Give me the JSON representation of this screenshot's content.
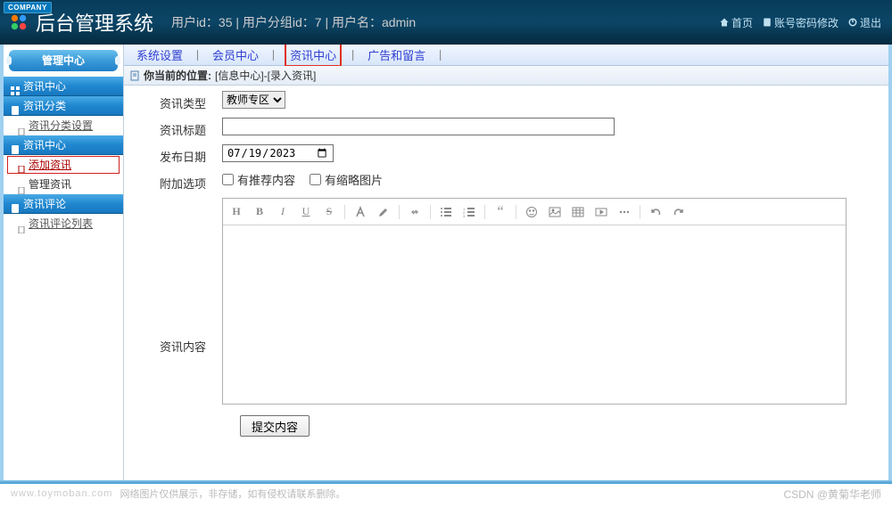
{
  "header": {
    "company_badge": "COMPANY",
    "title": "后台管理系统",
    "userinfo": "用户id：35 | 用户分组id：7 | 用户名：admin",
    "links": {
      "home": "首页",
      "password": "账号密码修改",
      "logout": "退出"
    }
  },
  "sidebar": {
    "tab": "管理中心",
    "groups": [
      {
        "label": "资讯中心",
        "type": "group"
      },
      {
        "label": "资讯分类",
        "type": "group"
      },
      {
        "label": "资讯分类设置",
        "type": "item_link"
      },
      {
        "label": "资讯中心",
        "type": "group"
      },
      {
        "label": "添加资讯",
        "type": "item_active"
      },
      {
        "label": "管理资讯",
        "type": "item"
      },
      {
        "label": "资讯评论",
        "type": "group"
      },
      {
        "label": "资讯评论列表",
        "type": "item_link"
      }
    ]
  },
  "topnav": {
    "items": [
      "系统设置",
      "会员中心",
      "资讯中心",
      "广告和留言"
    ],
    "active_index": 2,
    "separator": "丨"
  },
  "breadcrumb": {
    "label": "你当前的位置",
    "path": "[信息中心]-[录入资讯]"
  },
  "form": {
    "type_label": "资讯类型",
    "type_value": "教师专区",
    "title_label": "资讯标题",
    "title_value": "",
    "date_label": "发布日期",
    "date_value": "2023/07/19",
    "options_label": "附加选项",
    "opt1": "有推荐内容",
    "opt2": "有缩略图片",
    "content_label": "资讯内容",
    "submit": "提交内容"
  },
  "footer": {
    "left": "www.toymoban.com",
    "mid": "网络图片仅供展示，非存储，如有侵权请联系删除。",
    "right": "CSDN @黄菊华老师"
  }
}
